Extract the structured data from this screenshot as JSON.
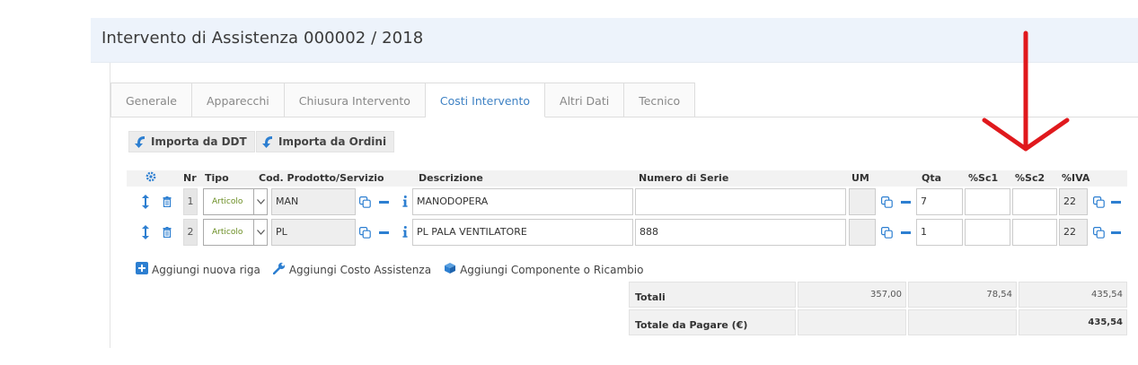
{
  "page": {
    "title": "Intervento di Assistenza 000002 / 2018"
  },
  "tabs": [
    "Generale",
    "Apparecchi",
    "Chiusura Intervento",
    "Costi Intervento",
    "Altri Dati",
    "Tecnico"
  ],
  "active_tab": "Costi Intervento",
  "buttons": {
    "import_ddt": "Importa da DDT",
    "import_orders": "Importa da Ordini"
  },
  "grid": {
    "columns": {
      "nr": "Nr",
      "tipo": "Tipo",
      "codice": "Cod. Prodotto/Servizio",
      "descrizione": "Descrizione",
      "serie": "Numero di Serie",
      "um": "UM",
      "qta": "Qta",
      "sc1": "%Sc1",
      "sc2": "%Sc2",
      "iva": "%IVA"
    },
    "rows": [
      {
        "nr": "1",
        "tipo": "Articolo",
        "codice": "MAN",
        "descrizione": "MANODOPERA",
        "serie": "",
        "um": "",
        "qta": "7",
        "sc1": "",
        "sc2": "",
        "iva": "22"
      },
      {
        "nr": "2",
        "tipo": "Articolo",
        "codice": "PL",
        "descrizione": "PL PALA VENTILATORE",
        "serie": "888",
        "um": "",
        "qta": "1",
        "sc1": "",
        "sc2": "",
        "iva": "22"
      }
    ]
  },
  "add_links": {
    "new_row": "Aggiungi nuova riga",
    "service_cost": "Aggiungi Costo Assistenza",
    "component": "Aggiungi Componente o Ricambio"
  },
  "totals": {
    "label": "Totali",
    "imponibile": "357,00",
    "iva": "78,54",
    "totale": "435,54",
    "pay_label": "Totale da Pagare (€)",
    "pay_value": "435,54"
  },
  "icons": {
    "settings": "gear-icon",
    "move": "updown-arrow-icon",
    "delete": "trash-icon",
    "copy": "copy-icon",
    "remove": "minus-icon",
    "info": "info-icon",
    "import": "curved-arrow-icon",
    "add": "plus-square-icon",
    "wrench": "wrench-icon",
    "box": "box-icon",
    "annotation": "red-down-arrow-icon"
  },
  "colors": {
    "accent": "#3f82c4",
    "header_bg": "#edf3fb",
    "annotation": "#e0191d",
    "article": "#6b8e23"
  }
}
